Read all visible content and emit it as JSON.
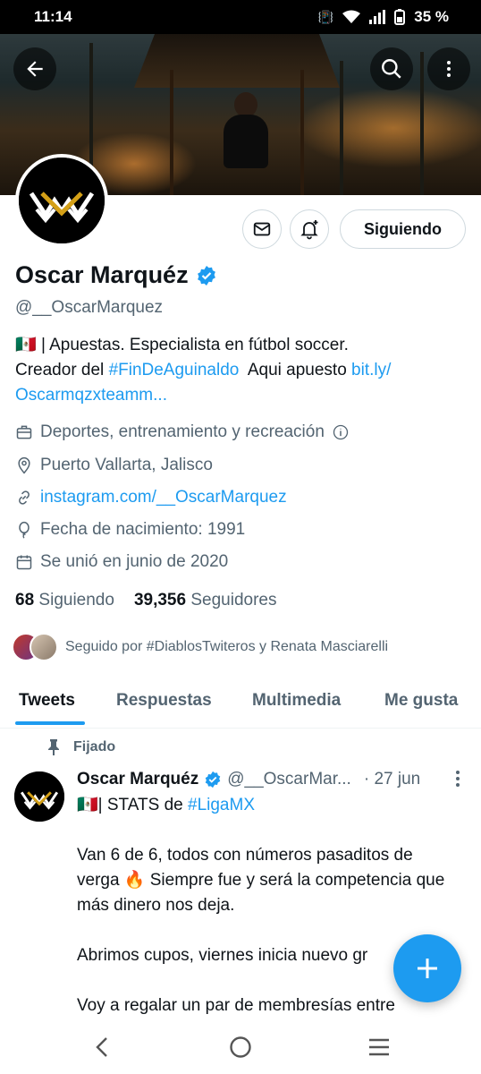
{
  "status_bar": {
    "time": "11:14",
    "battery": "35 %"
  },
  "profile": {
    "name": "Oscar Marquéz",
    "handle": "@__OscarMarquez",
    "follow_button": "Siguiendo",
    "bio": {
      "flag": "🇲🇽",
      "line1_text": " | Apuestas. Especialista en fútbol soccer.",
      "line2_prefix": "Creador del ",
      "hashtag": "#FinDeAguinaldo",
      "line2_mid": "  Aqui apuesto ",
      "link1": "bit.ly/",
      "link2": "Oscarmqzxteamm..."
    },
    "meta": {
      "category": "Deportes, entrenamiento y recreación",
      "location": "Puerto Vallarta, Jalisco",
      "website": "instagram.com/__OscarMarquez",
      "birth": "Fecha de nacimiento: 1991",
      "joined": "Se unió en junio de 2020"
    },
    "counts": {
      "following_num": "68",
      "following_label": "Siguiendo",
      "followers_num": "39,356",
      "followers_label": "Seguidores"
    },
    "followed_by": "Seguido por #DiablosTwiteros y Renata Masciarelli"
  },
  "tabs": [
    "Tweets",
    "Respuestas",
    "Multimedia",
    "Me gusta"
  ],
  "tweet": {
    "pinned_label": "Fijado",
    "name": "Oscar Marquéz",
    "handle": "@__OscarMar...",
    "time": "· 27 jun",
    "line1_flag": "🇲🇽",
    "line1_text": "| STATS de ",
    "line1_tag": "#LigaMX",
    "para2_a": "Van 6 de 6, todos con números pasaditos de verga ",
    "para2_emoji": "🔥",
    "para2_b": " Siempre fue y será la competencia que más dinero nos deja.",
    "para3": "Abrimos cupos, viernes inicia nuevo gr",
    "para4": "Voy a regalar un par de membresías entre"
  },
  "colors": {
    "accent": "#1d9bf0",
    "text_primary": "#0f1419",
    "text_secondary": "#536471",
    "gold": "#d4a017"
  },
  "icons": {
    "back": "arrow-left-icon",
    "search": "search-icon",
    "more": "more-vertical-icon",
    "message": "envelope-icon",
    "notify": "bell-plus-icon",
    "fab": "plus-icon"
  }
}
